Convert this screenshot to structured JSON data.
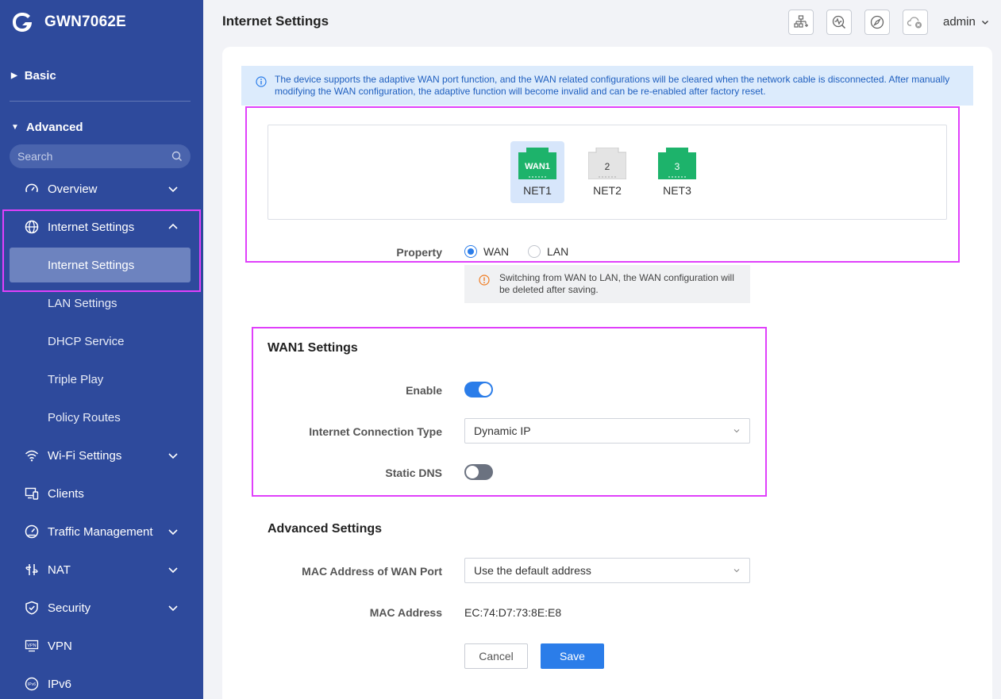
{
  "app": {
    "device_name": "GWN7062E",
    "page_title": "Internet Settings",
    "user": "admin"
  },
  "sidebar": {
    "basic_label": "Basic",
    "advanced_label": "Advanced",
    "search_placeholder": "Search",
    "items": [
      {
        "label": "Overview",
        "icon": "gauge-icon",
        "expandable": true
      },
      {
        "label": "Internet Settings",
        "icon": "globe-icon",
        "expandable": true,
        "expanded": true
      },
      {
        "label": "Wi-Fi Settings",
        "icon": "wifi-icon",
        "expandable": true
      },
      {
        "label": "Clients",
        "icon": "devices-icon",
        "expandable": false
      },
      {
        "label": "Traffic Management",
        "icon": "speedometer-icon",
        "expandable": true
      },
      {
        "label": "NAT",
        "icon": "nat-icon",
        "expandable": true
      },
      {
        "label": "Security",
        "icon": "shield-icon",
        "expandable": true
      },
      {
        "label": "VPN",
        "icon": "vpn-icon",
        "expandable": false
      },
      {
        "label": "IPv6",
        "icon": "ipv6-icon",
        "expandable": false
      }
    ],
    "sub_items": [
      "Internet Settings",
      "LAN Settings",
      "DHCP Service",
      "Triple Play",
      "Policy Routes"
    ],
    "active_sub_item": "Internet Settings"
  },
  "toolbar": {
    "icons": [
      "topology-icon",
      "diagnostics-icon",
      "compass-icon",
      "cloud-disconnected-icon"
    ]
  },
  "banner": {
    "text": "The device supports the adaptive WAN port function, and the WAN related configurations will be cleared when the network cable is disconnected. After manually modifying the WAN configuration, the adaptive function will become invalid and can be re-enabled after factory reset."
  },
  "ports": [
    {
      "badge": "WAN1",
      "name": "NET1",
      "color": "#1db36b",
      "selected": true
    },
    {
      "badge": "2",
      "name": "NET2",
      "color": "#e4e4e4",
      "selected": false
    },
    {
      "badge": "3",
      "name": "NET3",
      "color": "#1db36b",
      "selected": false
    }
  ],
  "property": {
    "label": "Property",
    "options": [
      "WAN",
      "LAN"
    ],
    "selected": "WAN",
    "warning": "Switching from WAN to LAN, the WAN configuration will be deleted after saving."
  },
  "wan_settings": {
    "title": "WAN1 Settings",
    "enable_label": "Enable",
    "enable": true,
    "connection_type_label": "Internet Connection Type",
    "connection_type": "Dynamic IP",
    "static_dns_label": "Static DNS",
    "static_dns": false
  },
  "advanced_settings": {
    "title": "Advanced Settings",
    "mac_port_label": "MAC Address of WAN Port",
    "mac_port_value": "Use the default address",
    "mac_label": "MAC Address",
    "mac_value": "EC:74:D7:73:8E:E8"
  },
  "buttons": {
    "cancel": "Cancel",
    "save": "Save"
  },
  "colors": {
    "sidebar_bg": "#2e4a9c",
    "accent": "#2b7de9",
    "highlight": "#e040fb",
    "port_green": "#1db36b"
  }
}
